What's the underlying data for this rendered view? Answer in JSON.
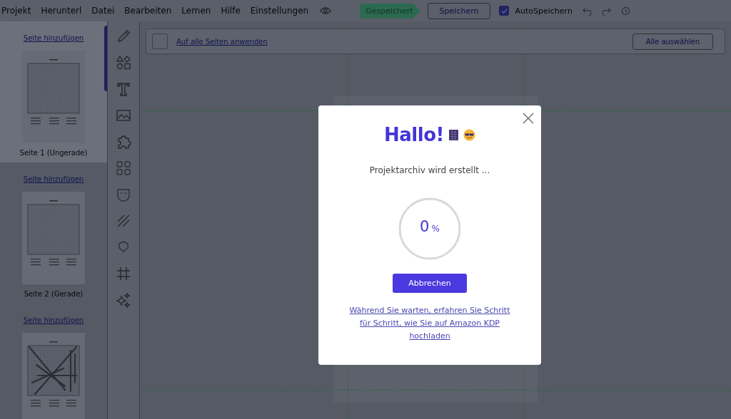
{
  "menu": [
    "Projekt",
    "Herunterl",
    "Datei",
    "Bearbeiten",
    "Lernen",
    "Hilfe",
    "Einstellungen"
  ],
  "save_status": "Gespeichert",
  "save_button": "Speichern",
  "autosave": {
    "label": "AutoSpeichern",
    "checked": true
  },
  "toolbar": {
    "apply_all": {
      "label": "Auf alle Seiten anwenden",
      "checked": false
    },
    "select_all": "Alle auswählen"
  },
  "pages": [
    {
      "add_label": "Seite hinzufügen",
      "caption": "Seite 1 (Ungerade)",
      "kind": "grid",
      "selected": true
    },
    {
      "add_label": "Seite hinzufügen",
      "caption": "Seite 2 (Gerade)",
      "kind": "grid",
      "selected": false
    },
    {
      "add_label": "Seite hinzufügen",
      "kind": "solved",
      "selected": false
    }
  ],
  "dialog": {
    "title": "Hallo!",
    "status": "Projektarchiv wird erstellt ...",
    "progress": {
      "value": "0",
      "unit": "%"
    },
    "cancel_button": "Abbrechen",
    "link": "Während Sie warten, erfahren Sie Schritt für Schritt, wie Sie auf Amazon KDP hochladen"
  }
}
